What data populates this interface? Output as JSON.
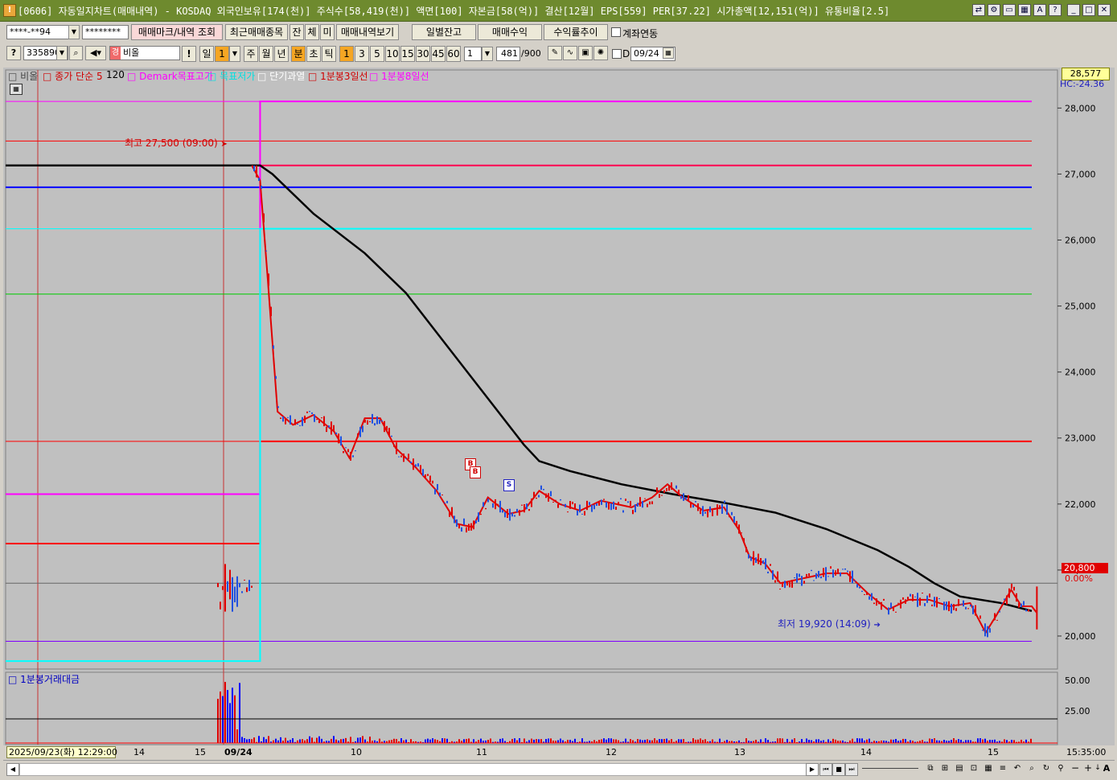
{
  "window": {
    "title": "[0606] 자동일지차트(매매내역) - KOSDAQ 외국인보유[174(천)] 주식수[58,419(천)] 액면[100] 자본금[58(억)] 결산[12월] EPS[559] PER[37.22] 시가총액[12,151(억)] 유통비율[2.5]"
  },
  "toolbar1": {
    "account": "****-**94",
    "password": "********",
    "btn_markers": "매매마크/내역 조회",
    "btn_recent": "최근매매종목",
    "btn_jan": "잔",
    "btn_che": "체",
    "btn_mi": "미",
    "btn_history": "매매내역보기",
    "btn_daily": "일별잔고",
    "btn_profit": "매매수익",
    "btn_rate": "수익률추이",
    "chk_link_label": "계좌연동"
  },
  "toolbar2": {
    "code": "335890",
    "stock_name": "비올",
    "mark": "!",
    "period_day": "일",
    "period_day_n": "1",
    "period_week": "주",
    "period_month": "월",
    "period_year": "년",
    "period_min": "분",
    "period_sec": "초",
    "period_tick": "틱",
    "intervals": [
      "1",
      "3",
      "5",
      "10",
      "15",
      "30",
      "45",
      "60"
    ],
    "interval_n": "1",
    "count": "481",
    "count_total": "/900",
    "chk_d": "D",
    "date": "09/24"
  },
  "legend": {
    "name": "비올",
    "ma": "종가 단순 5",
    "ma2": "120",
    "demark_high": "Demark목표고가",
    "demark_low": "목표저가",
    "overheat": "단기과열",
    "line3": "1분봉3일선",
    "line8": "1분봉8일선",
    "sub": "1분봉거래대금"
  },
  "annotations": {
    "high": "최고 27,500 (09:00)",
    "low": "최저 19,920 (14:09)",
    "marker_b": "B",
    "marker_s": "S"
  },
  "price_axis": {
    "ticks": [
      "28,000",
      "27,000",
      "26,000",
      "25,000",
      "24,000",
      "23,000",
      "22,000",
      "21,000",
      "20,000"
    ],
    "top_label": "28,577",
    "hc_label": "HC:-24.36",
    "current": "20,800",
    "current_pct": "0.00%"
  },
  "volume_axis": {
    "ticks": [
      "50.00",
      "25.00"
    ]
  },
  "time_axis": {
    "date_stamp": "2025/09/23(화) 12:29:00",
    "labels": [
      "14",
      "15",
      "09/24",
      "10",
      "11",
      "12",
      "13",
      "14",
      "15"
    ],
    "clock": "15:35:00"
  },
  "chart_data": {
    "type": "line",
    "title": "",
    "ylim": [
      19500,
      28577
    ],
    "levels": [
      {
        "value": 28100,
        "color": "#ff00ff"
      },
      {
        "value": 27500,
        "color": "#ff0000"
      },
      {
        "value": 27130,
        "color": "#ff0050"
      },
      {
        "value": 26800,
        "color": "#0000ff"
      },
      {
        "value": 26170,
        "color": "#00ffff"
      },
      {
        "value": 25180,
        "color": "#00cc00"
      },
      {
        "value": 22950,
        "color": "#ff0000"
      },
      {
        "value": 19920,
        "color": "#8000ff"
      }
    ],
    "series": [
      {
        "color": "#ff0000",
        "style": "step",
        "values": [
          [
            0,
            21400
          ],
          [
            0.248,
            21400
          ],
          [
            0.248,
            22950
          ],
          [
            1,
            22950
          ]
        ]
      },
      {
        "color": "#ff00ff",
        "style": "step",
        "values": [
          [
            0,
            22150
          ],
          [
            0.248,
            22150
          ],
          [
            0.248,
            28100
          ],
          [
            1,
            28100
          ]
        ]
      },
      {
        "color": "#00ffff",
        "style": "step",
        "values": [
          [
            0,
            19620
          ],
          [
            0.248,
            19620
          ],
          [
            0.248,
            26170
          ],
          [
            1,
            26170
          ]
        ]
      },
      {
        "color": "#000000",
        "values": [
          [
            0,
            27130
          ],
          [
            0.248,
            27130
          ],
          [
            0.26,
            27000
          ],
          [
            0.3,
            26400
          ],
          [
            0.35,
            25800
          ],
          [
            0.39,
            25200
          ],
          [
            0.43,
            24400
          ],
          [
            0.47,
            23600
          ],
          [
            0.505,
            22900
          ],
          [
            0.52,
            22650
          ],
          [
            0.55,
            22500
          ],
          [
            0.6,
            22300
          ],
          [
            0.65,
            22150
          ],
          [
            0.7,
            22020
          ],
          [
            0.75,
            21870
          ],
          [
            0.8,
            21620
          ],
          [
            0.85,
            21300
          ],
          [
            0.88,
            21050
          ],
          [
            0.905,
            20800
          ],
          [
            0.93,
            20600
          ],
          [
            0.97,
            20500
          ],
          [
            1,
            20380
          ]
        ]
      },
      {
        "color": "#e00000",
        "values": [
          [
            0.24,
            27130
          ],
          [
            0.248,
            26900
          ],
          [
            0.255,
            25500
          ],
          [
            0.265,
            23400
          ],
          [
            0.28,
            23200
          ],
          [
            0.3,
            23350
          ],
          [
            0.32,
            23100
          ],
          [
            0.335,
            22700
          ],
          [
            0.35,
            23300
          ],
          [
            0.365,
            23300
          ],
          [
            0.38,
            22850
          ],
          [
            0.4,
            22550
          ],
          [
            0.42,
            22200
          ],
          [
            0.44,
            21700
          ],
          [
            0.455,
            21650
          ],
          [
            0.47,
            22100
          ],
          [
            0.49,
            21850
          ],
          [
            0.505,
            21900
          ],
          [
            0.52,
            22200
          ],
          [
            0.54,
            22000
          ],
          [
            0.56,
            21900
          ],
          [
            0.58,
            22050
          ],
          [
            0.61,
            21950
          ],
          [
            0.63,
            22100
          ],
          [
            0.645,
            22300
          ],
          [
            0.66,
            22100
          ],
          [
            0.68,
            21900
          ],
          [
            0.7,
            21950
          ],
          [
            0.715,
            21600
          ],
          [
            0.725,
            21200
          ],
          [
            0.74,
            21100
          ],
          [
            0.755,
            20800
          ],
          [
            0.77,
            20850
          ],
          [
            0.785,
            20900
          ],
          [
            0.8,
            20950
          ],
          [
            0.82,
            20950
          ],
          [
            0.84,
            20650
          ],
          [
            0.86,
            20400
          ],
          [
            0.88,
            20550
          ],
          [
            0.9,
            20550
          ],
          [
            0.92,
            20450
          ],
          [
            0.94,
            20500
          ],
          [
            0.955,
            20050
          ],
          [
            0.965,
            20300
          ],
          [
            0.98,
            20700
          ],
          [
            0.99,
            20450
          ],
          [
            1,
            20450
          ],
          [
            1.02,
            20350
          ],
          [
            1.04,
            20100
          ],
          [
            1.055,
            20300
          ],
          [
            1.07,
            20450
          ],
          [
            1.09,
            20350
          ],
          [
            1.1,
            20750
          ]
        ]
      }
    ]
  }
}
